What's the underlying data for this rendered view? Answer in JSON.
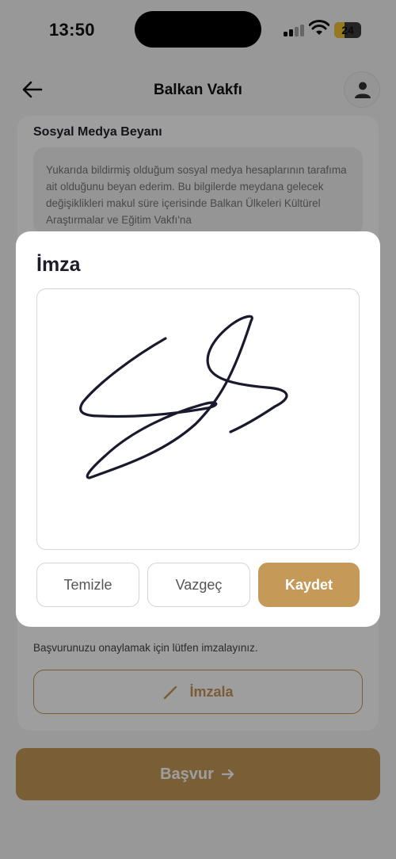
{
  "status_bar": {
    "time": "13:50",
    "battery": "24"
  },
  "nav": {
    "title": "Balkan Vakfı",
    "back_icon": "arrow-left-icon",
    "profile_icon": "user-icon"
  },
  "form": {
    "section_title": "Sosyal Medya Beyanı",
    "declaration_text": "Yukarıda bildirmiş olduğum sosyal medya hesaplarının tarafıma ait olduğunu beyan ederim. Bu bilgilerde meydana gelecek değişiklikleri makul süre içerisinde Balkan Ülkeleri Kültürel Araştırmalar ve Eğitim Vakfı'na",
    "sign_prompt": "Başvurunuzu onaylamak için lütfen imzalayınız.",
    "sign_button_label": "İmzala",
    "sign_button_icon": "pencil-icon",
    "apply_button_label": "Başvur",
    "apply_button_icon": "arrow-right-icon"
  },
  "modal": {
    "title": "İmza",
    "clear_label": "Temizle",
    "cancel_label": "Vazgeç",
    "save_label": "Kaydet"
  },
  "colors": {
    "accent": "#c59a58",
    "title_text": "#1c1c2a",
    "signature_stroke": "#1a1a2e"
  }
}
